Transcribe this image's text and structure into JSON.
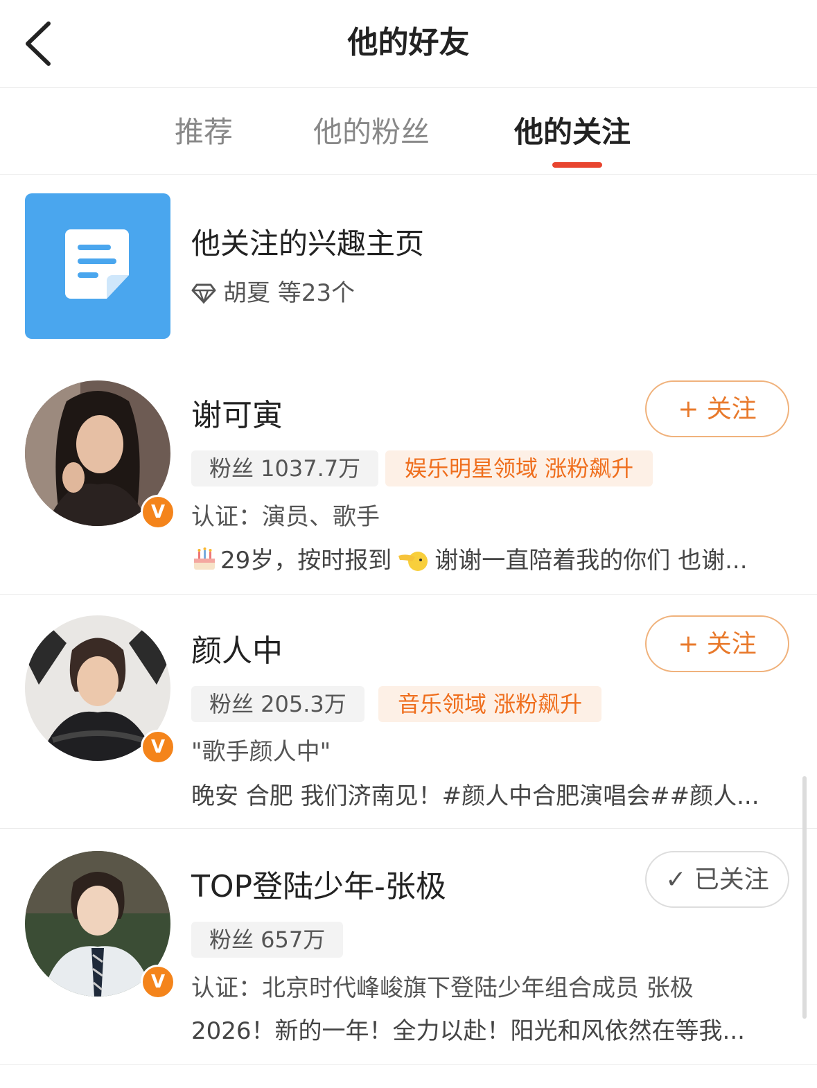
{
  "header": {
    "title": "他的好友"
  },
  "tabs": [
    {
      "label": "推荐"
    },
    {
      "label": "他的粉丝"
    },
    {
      "label": "他的关注",
      "active": true
    }
  ],
  "accent_color": "#e8452f",
  "interest": {
    "title": "他关注的兴趣主页",
    "sub": "胡夏 等23个",
    "tile_color": "#4aa6ee"
  },
  "users": [
    {
      "name": "谢可寅",
      "fans": "粉丝 1037.7万",
      "rise_tag": "娱乐明星领域 涨粉飙升",
      "line1": "认证：演员、歌手",
      "line2_a": "29岁，按时报到",
      "line2_b": "谢谢一直陪着我的你们 也谢...",
      "button": "+ 关注",
      "button_state": "follow",
      "verified": "V"
    },
    {
      "name": "颜人中",
      "fans": "粉丝 205.3万",
      "rise_tag": "音乐领域 涨粉飙升",
      "line1": "\"歌手颜人中\"",
      "line2": "晚安 合肥 我们济南见！#颜人中合肥演唱会##颜人...",
      "button": "+ 关注",
      "button_state": "follow",
      "verified": "V"
    },
    {
      "name": "TOP登陆少年-张极",
      "fans": "粉丝 657万",
      "line1": "认证：北京时代峰峻旗下登陆少年组合成员 张极",
      "line2": "2026！新的一年！全力以赴！阳光和风依然在等我...",
      "button": "✓ 已关注",
      "button_state": "followed",
      "verified": "V"
    }
  ]
}
